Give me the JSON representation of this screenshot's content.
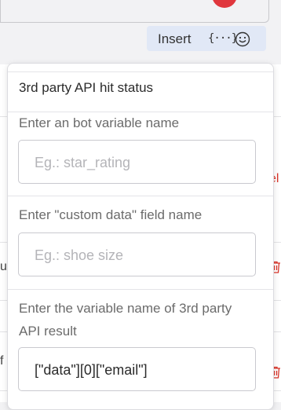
{
  "background": {
    "fragments": {
      "row1_right": "el",
      "row2_left": "u",
      "row3_left": "f"
    },
    "trash_icon": "trash-icon",
    "accent_red": "#d9352a"
  },
  "insert_bar": {
    "label": "Insert",
    "brace_icon_text": "{···}",
    "emoji_icon": "smile-icon"
  },
  "popover": {
    "title": "3rd party API hit status",
    "fields": [
      {
        "label": "Enter an bot variable name",
        "placeholder": "Eg.: star_rating",
        "value": ""
      },
      {
        "label": "Enter \"custom data\" field name",
        "placeholder": "Eg.: shoe size",
        "value": ""
      },
      {
        "label": "Enter the variable name of 3rd party API result",
        "placeholder": "",
        "value": "[\"data\"][0][\"email\"]"
      }
    ]
  }
}
